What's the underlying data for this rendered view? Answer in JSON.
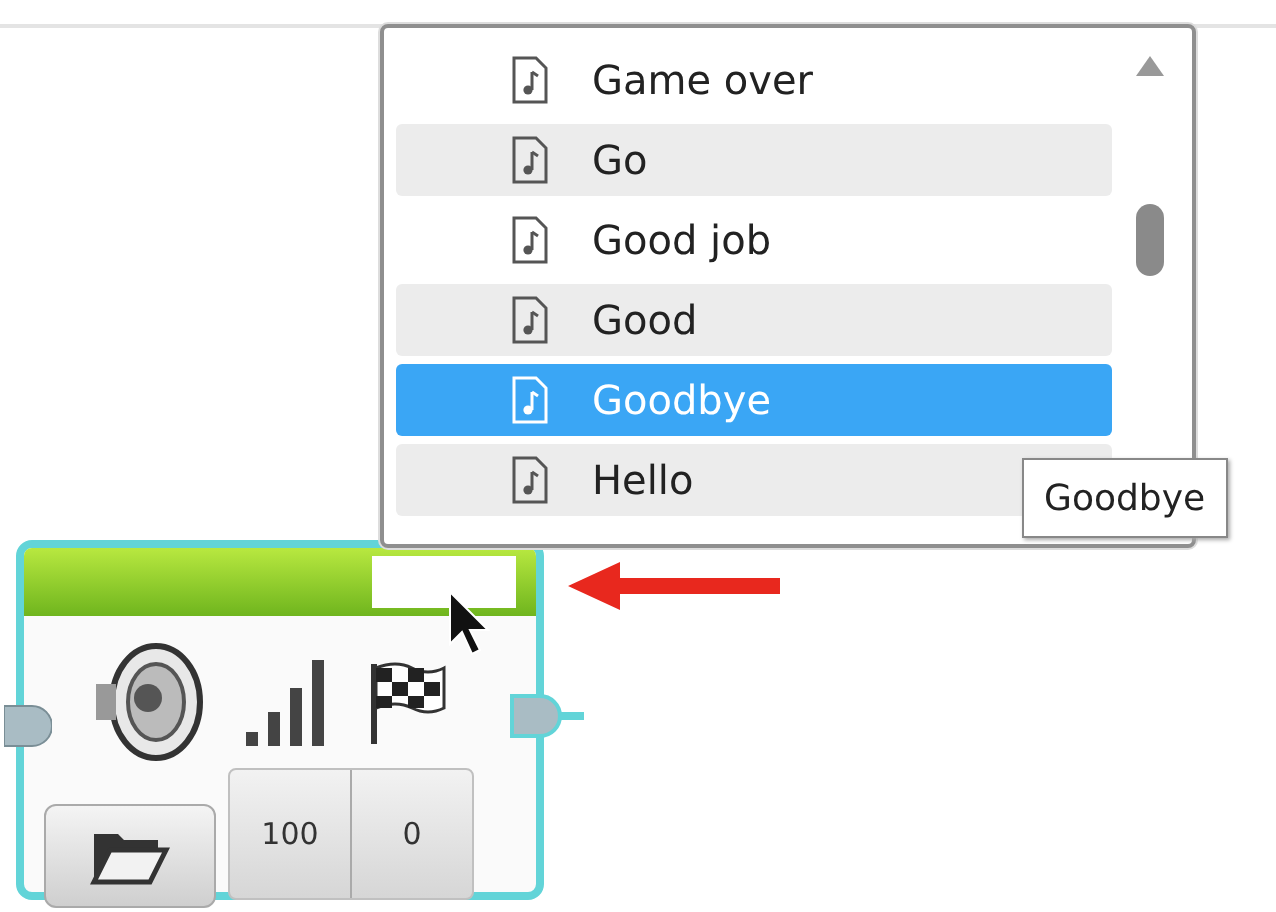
{
  "sound_list": {
    "items": [
      {
        "label": "Game over",
        "selected": false
      },
      {
        "label": "Go",
        "selected": false
      },
      {
        "label": "Good job",
        "selected": false
      },
      {
        "label": "Good",
        "selected": false
      },
      {
        "label": "Goodbye",
        "selected": true
      },
      {
        "label": "Hello",
        "selected": false
      }
    ]
  },
  "tooltip": {
    "text": "Goodbye"
  },
  "sound_block": {
    "inputs": [
      {
        "value": "100"
      },
      {
        "value": "0"
      }
    ]
  }
}
